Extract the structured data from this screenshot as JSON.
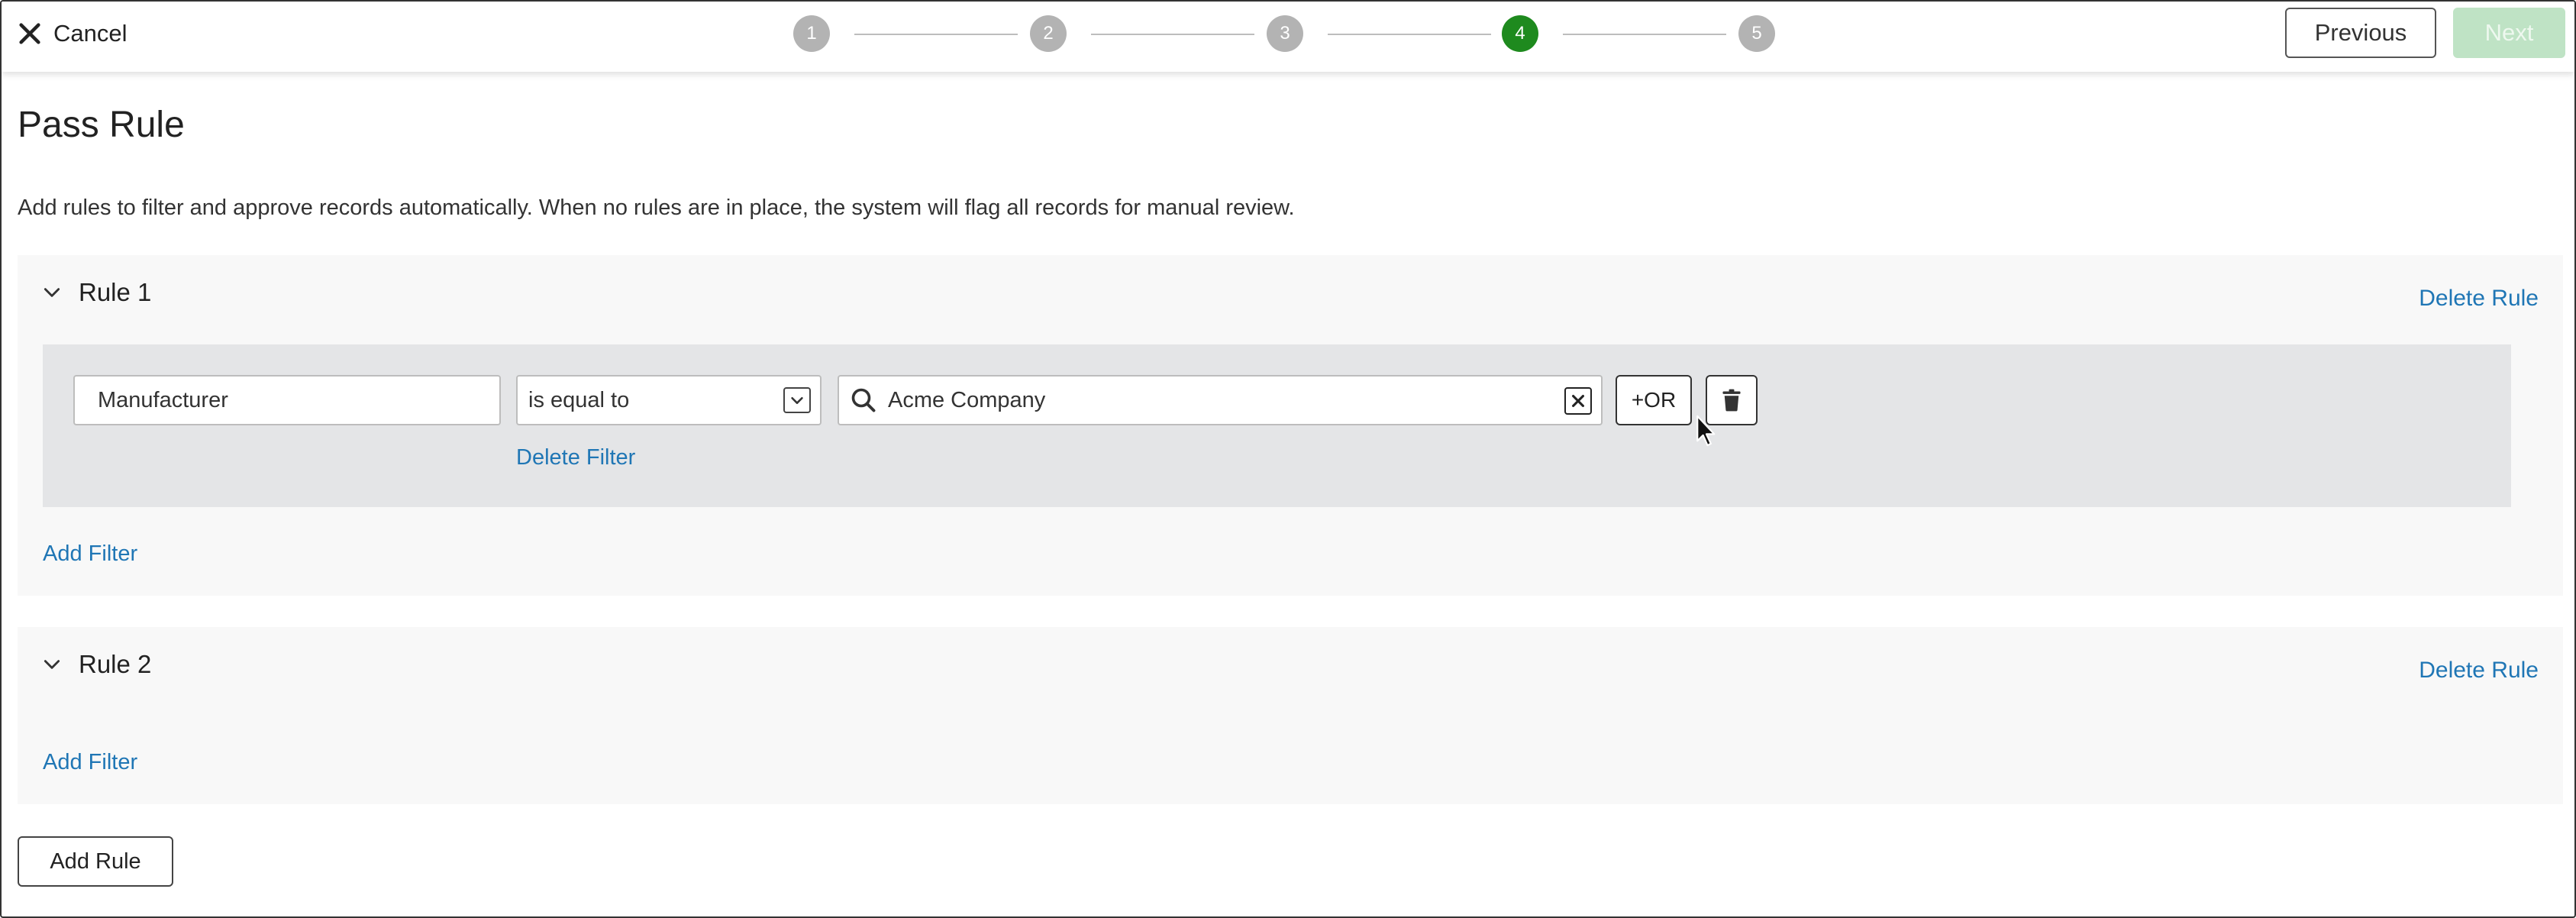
{
  "header": {
    "cancel_label": "Cancel",
    "steps": [
      "1",
      "2",
      "3",
      "4",
      "5"
    ],
    "active_step": 4,
    "previous_label": "Previous",
    "next_label": "Next"
  },
  "page": {
    "title": "Pass Rule",
    "description": "Add rules to filter and approve records automatically. When no rules are in place, the system will flag all records for manual review."
  },
  "rules": [
    {
      "title": "Rule 1",
      "delete_label": "Delete Rule",
      "filter": {
        "attribute": "Manufacturer",
        "operator": "is equal to",
        "value": "Acme Company",
        "or_label": "+OR",
        "delete_filter_label": "Delete Filter"
      },
      "add_filter_label": "Add Filter"
    },
    {
      "title": "Rule 2",
      "delete_label": "Delete Rule",
      "add_filter_label": "Add Filter"
    }
  ],
  "add_rule_label": "Add Rule",
  "colors": {
    "link": "#1f76b5",
    "active_step": "#1e8a1e",
    "inactive_step": "#b3b3b3",
    "next_disabled": "#bfe3c5"
  }
}
